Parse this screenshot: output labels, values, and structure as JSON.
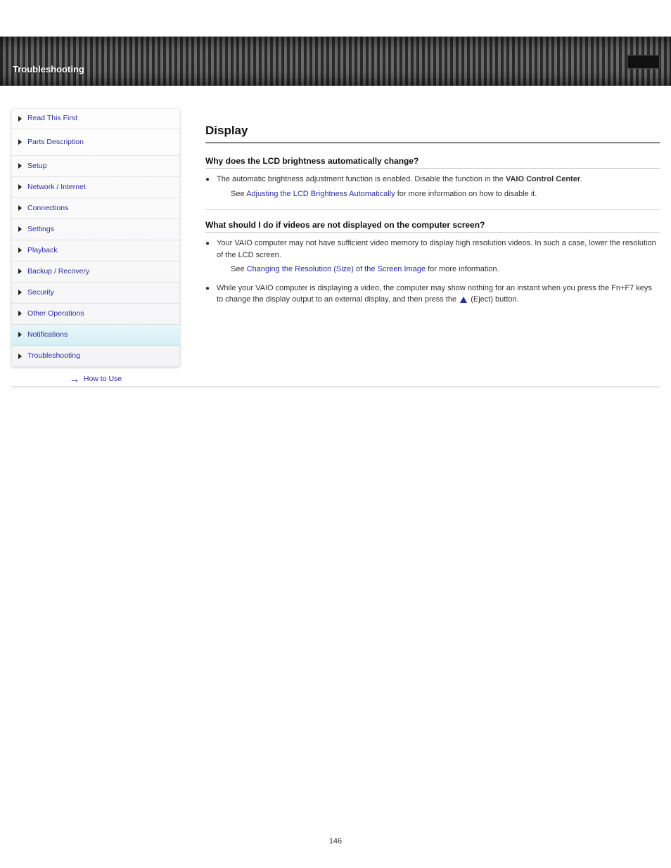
{
  "header": {
    "title": "Troubleshooting"
  },
  "sidebar": {
    "items": [
      {
        "label": "Read This First"
      },
      {
        "label": "Parts Description"
      },
      {
        "label": "Setup"
      },
      {
        "label": "Network / Internet"
      },
      {
        "label": "Connections"
      },
      {
        "label": "Settings"
      },
      {
        "label": "Playback"
      },
      {
        "label": "Backup / Recovery"
      },
      {
        "label": "Security"
      },
      {
        "label": "Other Operations"
      },
      {
        "label": "Notifications"
      },
      {
        "label": "Troubleshooting"
      }
    ],
    "active_index": 10,
    "footer_label": "How to Use"
  },
  "main": {
    "title": "Display",
    "qa": [
      {
        "q": "Why does the LCD brightness automatically change?",
        "a": "The automatic brightness adjustment function is enabled. Disable the function in the VAIO Control Center. See Adjusting the LCD Brightness Automatically for more information on how to disable it.",
        "has_link": true,
        "link_text": "Adjusting the LCD Brightness Automatically"
      },
      {
        "q": "What should I do if videos are not displayed on the computer screen?",
        "a1": "Your VAIO computer may not have sufficient video memory to display high resolution videos. In such a case, lower the resolution of the LCD screen.",
        "a1_link": "Changing the Resolution (Size) of the Screen Image",
        "a1_suffix": " for more information.",
        "a2_prefix": "While your VAIO computer is displaying a video, the computer may show nothing for an instant when you press the Fn+F7 keys to change the display output to an external display, and then press the ",
        "a2_suffix": " (Eject) button."
      }
    ]
  },
  "page_number": "146"
}
